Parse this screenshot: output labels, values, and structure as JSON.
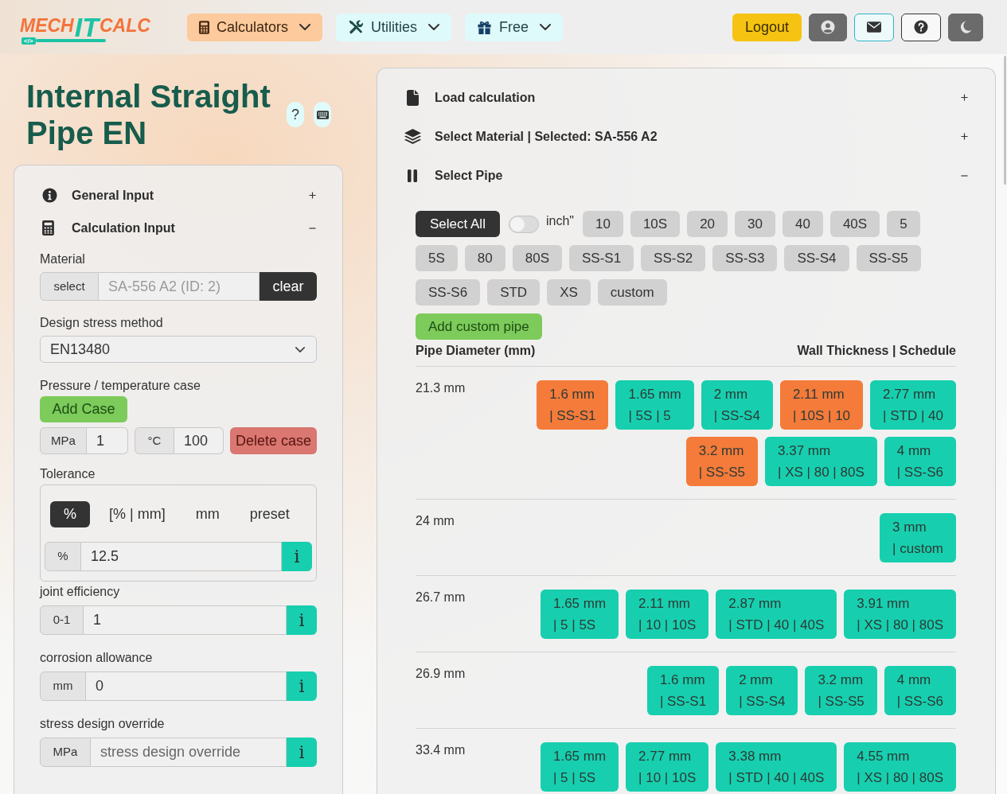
{
  "header": {
    "logo": {
      "parts": [
        "MECH",
        "IT",
        "CALC"
      ],
      "tag": "</>"
    },
    "nav": [
      {
        "label": "Calculators",
        "selected": true
      },
      {
        "label": "Utilities",
        "selected": false
      },
      {
        "label": "Free",
        "selected": false
      }
    ],
    "logout_button": "Logout"
  },
  "page_title": "Internal Straight Pipe EN",
  "help_button": "?",
  "left_panel": {
    "sections": [
      {
        "title": "General Input",
        "expanded": false
      },
      {
        "title": "Calculation Input",
        "expanded": true
      }
    ],
    "material": {
      "label": "Material",
      "select_button": "select",
      "value": "SA-556 A2 (ID: 2)",
      "disabled": true,
      "clear_button": "clear"
    },
    "design_stress_method": {
      "label": "Design stress method",
      "value": "EN13480"
    },
    "pressure_temperature": {
      "label": "Pressure / temperature case",
      "add_button": "Add Case",
      "cases": [
        {
          "pressure_unit": "MPa",
          "pressure": "1",
          "temperature_unit": "°C",
          "temperature": "100",
          "delete_button": "Delete case"
        }
      ]
    },
    "tolerance": {
      "label": "Tolerance",
      "modes": [
        {
          "label": "%",
          "selected": true
        },
        {
          "label": "[% | mm]",
          "selected": false
        },
        {
          "label": "mm",
          "selected": false
        },
        {
          "label": "preset",
          "selected": false
        }
      ],
      "unit": "%",
      "value": "12.5",
      "info_button": "i"
    },
    "fields": [
      {
        "label": "joint efficiency",
        "unit": "0-1",
        "value": "1",
        "info_button": "i"
      },
      {
        "label": "corrosion allowance",
        "unit": "mm",
        "value": "0",
        "info_button": "i"
      },
      {
        "label": "stress design override",
        "unit": "MPa",
        "placeholder": "stress design override",
        "info_button": "i"
      }
    ]
  },
  "right_panel": {
    "sections": [
      {
        "title": "Load calculation",
        "expanded": false
      },
      {
        "title": "Select Material | Selected: SA-556 A2",
        "expanded": false
      },
      {
        "title": "Select Pipe",
        "expanded": true
      }
    ],
    "select_all_button": "Select All",
    "inch_toggle": {
      "label": "inch\"",
      "on": false
    },
    "schedule_filters": [
      {
        "label": "10",
        "selected": false
      },
      {
        "label": "10S",
        "selected": false
      },
      {
        "label": "20",
        "selected": false
      },
      {
        "label": "30",
        "selected": false
      },
      {
        "label": "40",
        "selected": false
      },
      {
        "label": "40S",
        "selected": false
      },
      {
        "label": "5",
        "selected": false
      },
      {
        "label": "5S",
        "selected": false
      },
      {
        "label": "80",
        "selected": false
      },
      {
        "label": "80S",
        "selected": false
      },
      {
        "label": "SS-S1",
        "selected": false
      },
      {
        "label": "SS-S2",
        "selected": false
      },
      {
        "label": "SS-S3",
        "selected": false
      },
      {
        "label": "SS-S4",
        "selected": false
      },
      {
        "label": "SS-S5",
        "selected": false
      },
      {
        "label": "SS-S6",
        "selected": false
      },
      {
        "label": "STD",
        "selected": false
      },
      {
        "label": "XS",
        "selected": false
      },
      {
        "label": "custom",
        "selected": false
      }
    ],
    "add_custom_pipe_button": "Add custom pipe",
    "table": {
      "columns": [
        "Pipe Diameter (mm)",
        "Wall Thickness | Schedule"
      ],
      "rows": [
        {
          "diameter": "21.3 mm",
          "pipes": [
            {
              "thickness": "1.6 mm",
              "schedules": "| SS-S1",
              "color": "#f47b3a"
            },
            {
              "thickness": "1.65 mm",
              "schedules": "| 5S | 5",
              "color": "#17cfae"
            },
            {
              "thickness": "2 mm",
              "schedules": "| SS-S4",
              "color": "#17cfae"
            },
            {
              "thickness": "2.11 mm",
              "schedules": "| 10S | 10",
              "color": "#f47b3a"
            },
            {
              "thickness": "2.77 mm",
              "schedules": "| STD | 40",
              "color": "#17cfae"
            },
            {
              "thickness": "3.2 mm",
              "schedules": "| SS-S5",
              "color": "#f47b3a"
            },
            {
              "thickness": "3.37 mm",
              "schedules": "| XS | 80 | 80S",
              "color": "#17cfae"
            },
            {
              "thickness": "4 mm",
              "schedules": "| SS-S6",
              "color": "#17cfae"
            }
          ]
        },
        {
          "diameter": "24 mm",
          "pipes": [
            {
              "thickness": "3 mm",
              "schedules": "| custom",
              "color": "#17cfae"
            }
          ]
        },
        {
          "diameter": "26.7 mm",
          "pipes": [
            {
              "thickness": "1.65 mm",
              "schedules": "| 5 | 5S",
              "color": "#17cfae"
            },
            {
              "thickness": "2.11 mm",
              "schedules": "| 10 | 10S",
              "color": "#17cfae"
            },
            {
              "thickness": "2.87 mm",
              "schedules": "| STD | 40 | 40S",
              "color": "#17cfae"
            },
            {
              "thickness": "3.91 mm",
              "schedules": "| XS | 80 | 80S",
              "color": "#17cfae"
            }
          ]
        },
        {
          "diameter": "26.9 mm",
          "pipes": [
            {
              "thickness": "1.6 mm",
              "schedules": "| SS-S1",
              "color": "#17cfae"
            },
            {
              "thickness": "2 mm",
              "schedules": "| SS-S4",
              "color": "#17cfae"
            },
            {
              "thickness": "3.2 mm",
              "schedules": "| SS-S5",
              "color": "#17cfae"
            },
            {
              "thickness": "4 mm",
              "schedules": "| SS-S6",
              "color": "#17cfae"
            }
          ]
        },
        {
          "diameter": "33.4 mm",
          "pipes": [
            {
              "thickness": "1.65 mm",
              "schedules": "| 5 | 5S",
              "color": "#17cfae"
            },
            {
              "thickness": "2.77 mm",
              "schedules": "| 10 | 10S",
              "color": "#17cfae"
            },
            {
              "thickness": "3.38 mm",
              "schedules": "| STD | 40 | 40S",
              "color": "#17cfae"
            },
            {
              "thickness": "4.55 mm",
              "schedules": "| XS | 80 | 80S",
              "color": "#17cfae"
            }
          ]
        }
      ]
    }
  }
}
